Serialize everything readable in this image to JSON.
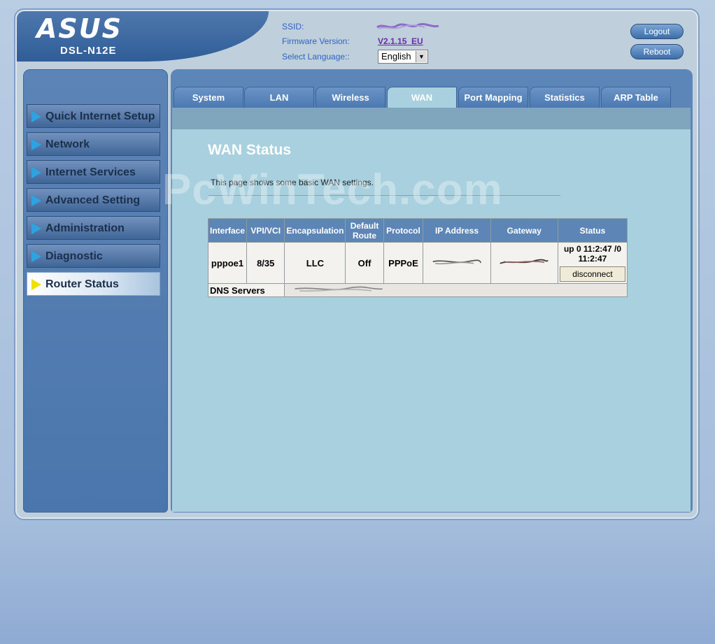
{
  "header": {
    "brand": "ASUS",
    "model": "DSL-N12E",
    "ssid_label": "SSID:",
    "firmware_label": "Firmware Version:",
    "firmware_value": "V2.1.15_EU",
    "language_label": "Select Language::",
    "language_value": "English",
    "logout_label": "Logout",
    "reboot_label": "Reboot"
  },
  "sidebar": {
    "items": [
      {
        "label": "Quick Internet Setup"
      },
      {
        "label": "Network"
      },
      {
        "label": "Internet Services"
      },
      {
        "label": "Advanced Setting"
      },
      {
        "label": "Administration"
      },
      {
        "label": "Diagnostic"
      },
      {
        "label": "Router Status"
      }
    ],
    "active": "Router Status"
  },
  "tabs": [
    {
      "label": "System"
    },
    {
      "label": "LAN"
    },
    {
      "label": "Wireless"
    },
    {
      "label": "WAN"
    },
    {
      "label": "Port Mapping"
    },
    {
      "label": "Statistics"
    },
    {
      "label": "ARP Table"
    }
  ],
  "active_tab": "WAN",
  "page": {
    "title": "WAN Status",
    "description": "This page shows some basic WAN settings.",
    "watermark": "PcWinTech.com"
  },
  "wan_table": {
    "headers": [
      "Interface",
      "VPI/VCI",
      "Encapsulation",
      "Default Route",
      "Protocol",
      "IP Address",
      "Gateway",
      "Status"
    ],
    "row": {
      "interface": "pppoe1",
      "vpi_vci": "8/35",
      "encapsulation": "LLC",
      "default_route": "Off",
      "protocol": "PPPoE",
      "status": "up 0 11:2:47 /0 11:2:47",
      "disconnect_label": "disconnect"
    },
    "dns_label": "DNS Servers"
  },
  "colors": {
    "accent": "#5d86b6",
    "content_bg": "#a8d0df",
    "link": "#6a2ca8"
  }
}
